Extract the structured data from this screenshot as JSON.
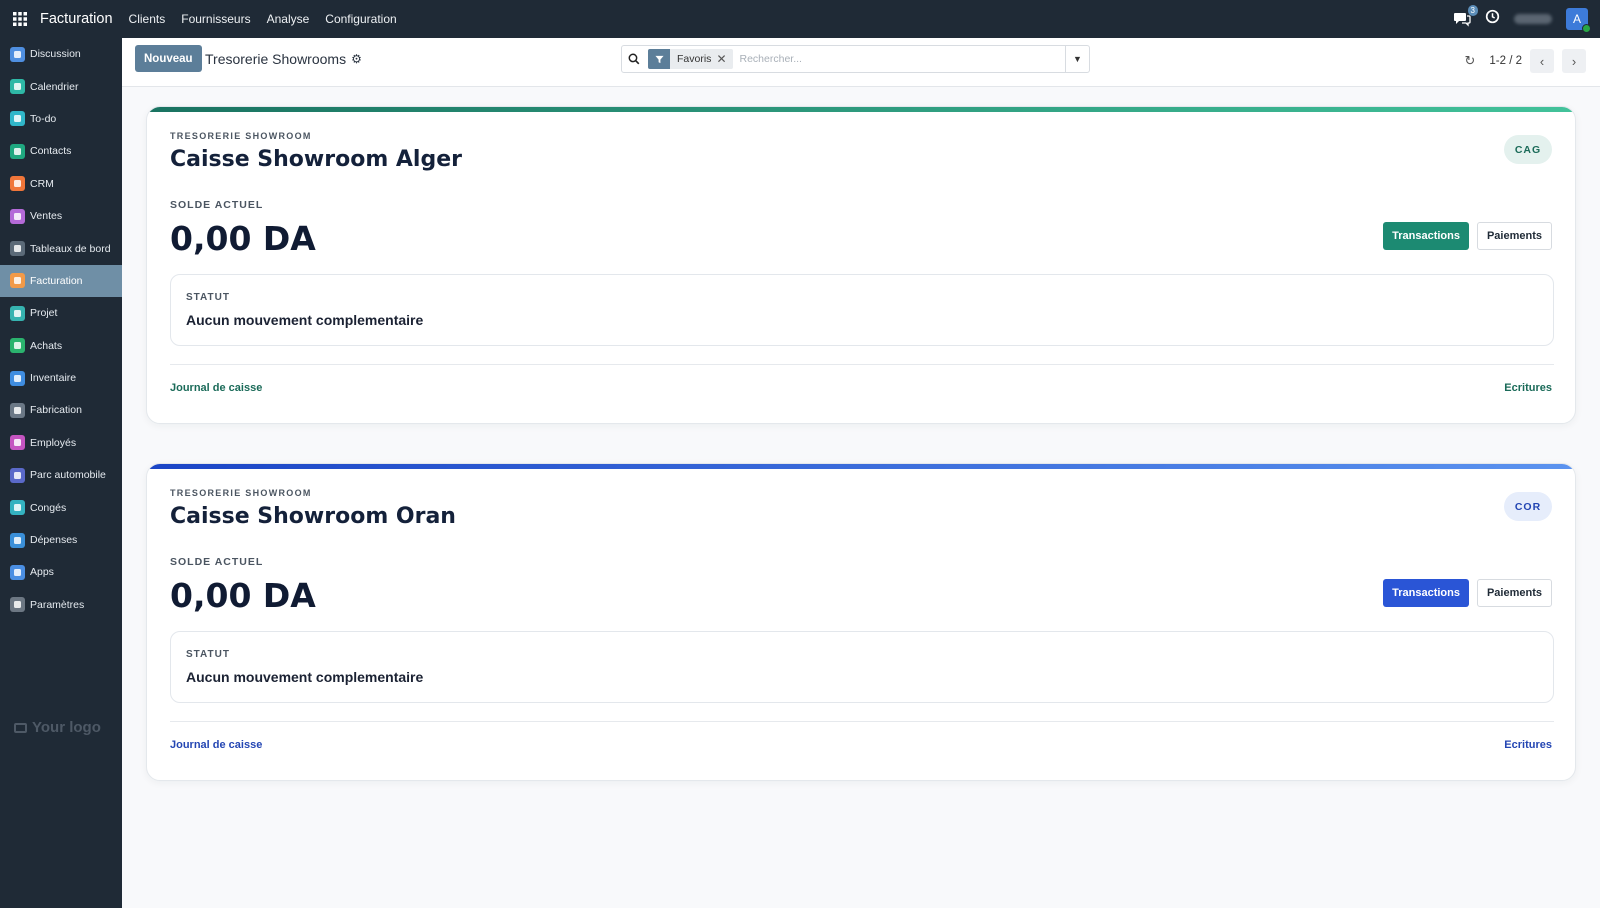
{
  "topbar": {
    "app_name": "Facturation",
    "menu": [
      "Clients",
      "Fournisseurs",
      "Analyse",
      "Configuration"
    ],
    "chat_count": "3",
    "avatar_letter": "A"
  },
  "sidebar": {
    "items": [
      {
        "label": "Discussion",
        "color": "#4f8fe0"
      },
      {
        "label": "Calendrier",
        "color": "#2eb8a6"
      },
      {
        "label": "To-do",
        "color": "#30b6c9"
      },
      {
        "label": "Contacts",
        "color": "#1fa880"
      },
      {
        "label": "CRM",
        "color": "#f0763a"
      },
      {
        "label": "Ventes",
        "color": "#b46ad8"
      },
      {
        "label": "Tableaux de bord",
        "color": "#5b6a78"
      },
      {
        "label": "Facturation",
        "color": "#f29a48"
      },
      {
        "label": "Projet",
        "color": "#36b3b0"
      },
      {
        "label": "Achats",
        "color": "#2bb36e"
      },
      {
        "label": "Inventaire",
        "color": "#3f8de0"
      },
      {
        "label": "Fabrication",
        "color": "#6b7886"
      },
      {
        "label": "Employés",
        "color": "#c454c0"
      },
      {
        "label": "Parc automobile",
        "color": "#5a69c9"
      },
      {
        "label": "Congés",
        "color": "#34b2c0"
      },
      {
        "label": "Dépenses",
        "color": "#3a8fd8"
      },
      {
        "label": "Apps",
        "color": "#4a8ee2"
      },
      {
        "label": "Paramètres",
        "color": "#6c7783"
      }
    ],
    "active_index": 7,
    "logo_text": "Your logo"
  },
  "control": {
    "new_button": "Nouveau",
    "title": "Tresorerie Showrooms",
    "filter_facet": "Favoris",
    "search_placeholder": "Rechercher...",
    "pager": "1-2 / 2"
  },
  "cards": [
    {
      "kicker": "TRESORERIE SHOWROOM",
      "name": "Caisse Showroom Alger",
      "code": "CAG",
      "solde_label": "SOLDE ACTUEL",
      "amount": "0,00 DA",
      "transactions_label": "Transactions",
      "paiements_label": "Paiements",
      "status_label": "STATUT",
      "status_text": "Aucun mouvement complementaire",
      "journal_link": "Journal de caisse",
      "ecritures_link": "Ecritures",
      "accent": "#1c8a72"
    },
    {
      "kicker": "TRESORERIE SHOWROOM",
      "name": "Caisse Showroom Oran",
      "code": "COR",
      "solde_label": "SOLDE ACTUEL",
      "amount": "0,00 DA",
      "transactions_label": "Transactions",
      "paiements_label": "Paiements",
      "status_label": "STATUT",
      "status_text": "Aucun mouvement complementaire",
      "journal_link": "Journal de caisse",
      "ecritures_link": "Ecritures",
      "accent": "#2a55d6"
    }
  ]
}
